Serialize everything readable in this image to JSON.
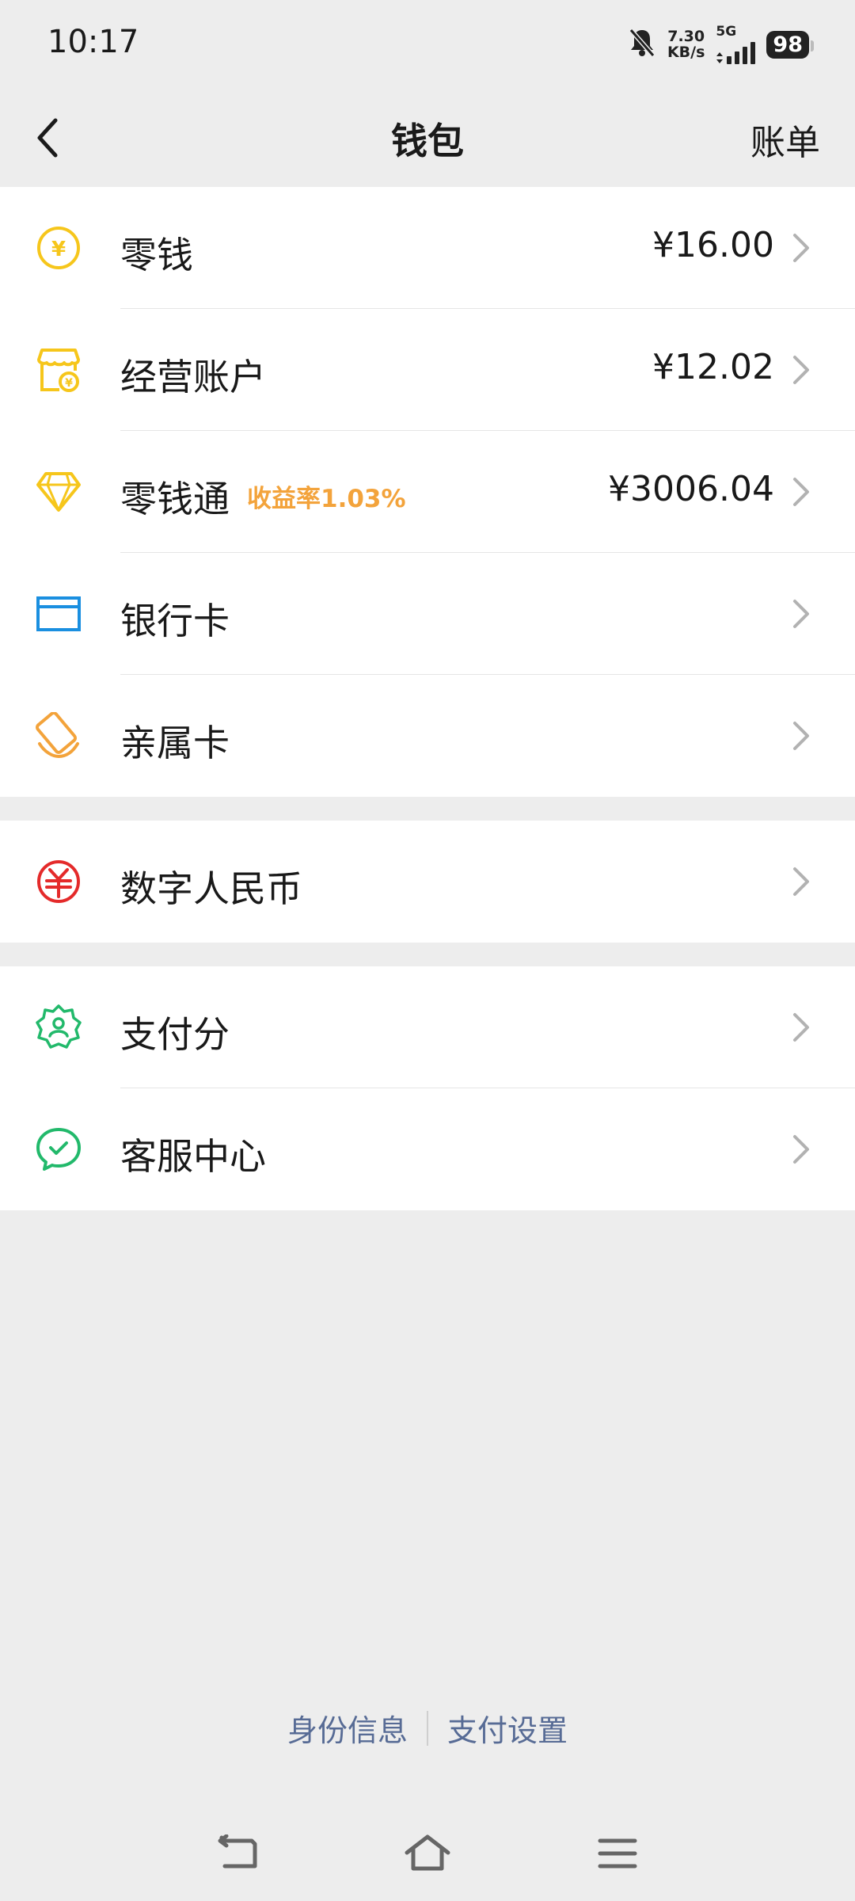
{
  "status_bar": {
    "time": "10:17",
    "speed_value": "7.30",
    "speed_unit": "KB/s",
    "network": "5G",
    "battery": "98"
  },
  "nav": {
    "title": "钱包",
    "action": "账单",
    "back_icon": "chevron-left-icon"
  },
  "groups": [
    {
      "rows": [
        {
          "icon": "yuan-coin-icon",
          "label": "零钱",
          "amount": "¥16.00",
          "color": "#f6c61b"
        },
        {
          "icon": "store-account-icon",
          "label": "经营账户",
          "amount": "¥12.02",
          "color": "#f6c61b"
        },
        {
          "icon": "diamond-icon",
          "label": "零钱通",
          "badge": "收益率1.03%",
          "amount": "¥3006.04",
          "color": "#f6c61b"
        },
        {
          "icon": "bank-card-icon",
          "label": "银行卡",
          "color": "#1a8fe0"
        },
        {
          "icon": "family-card-icon",
          "label": "亲属卡",
          "color": "#f3a33b"
        }
      ]
    },
    {
      "rows": [
        {
          "icon": "digital-rmb-icon",
          "label": "数字人民币",
          "color": "#e42a2a"
        }
      ]
    },
    {
      "rows": [
        {
          "icon": "pay-score-icon",
          "label": "支付分",
          "color": "#22b96b"
        },
        {
          "icon": "customer-service-icon",
          "label": "客服中心",
          "color": "#22b96b"
        }
      ]
    }
  ],
  "footer": {
    "identity": "身份信息",
    "pay_settings": "支付设置"
  },
  "system_nav": {
    "back": "back-icon",
    "home": "home-icon",
    "menu": "menu-icon"
  },
  "colors": {
    "background": "#ededed",
    "link": "#576b95",
    "badge": "#f3a33b"
  }
}
